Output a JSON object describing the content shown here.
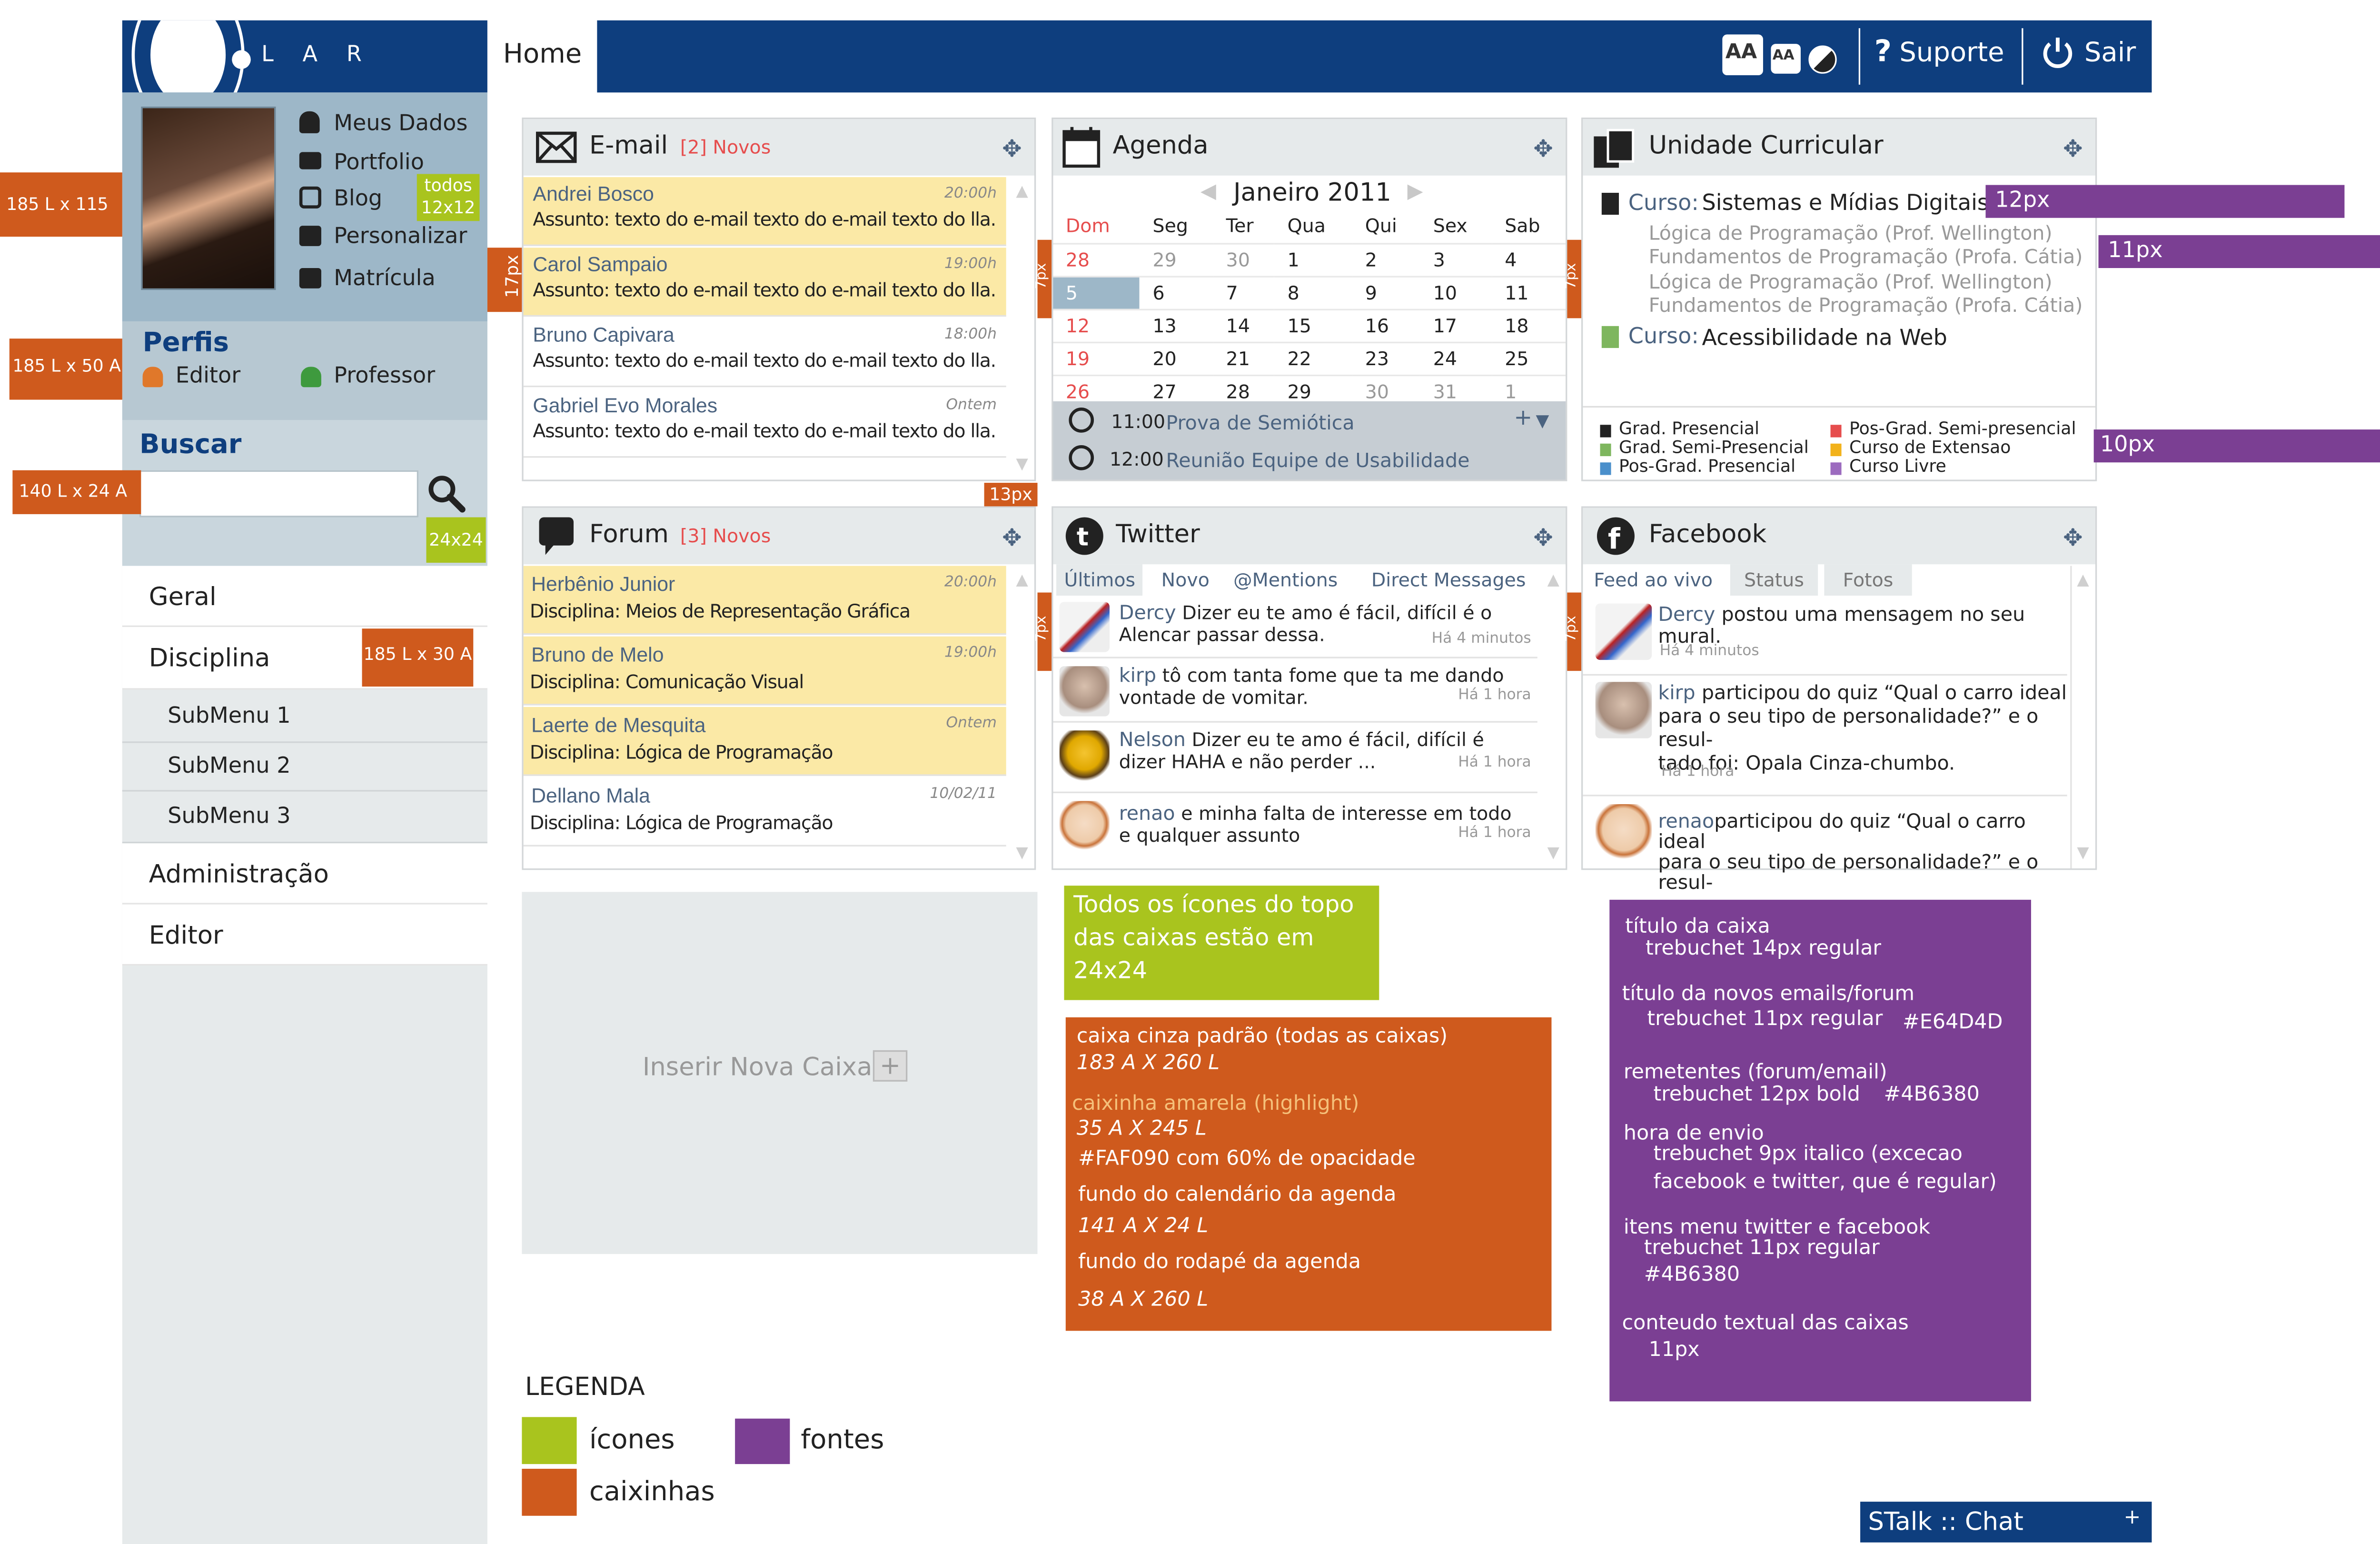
{
  "logo": {
    "text": "S  L A R"
  },
  "header": {
    "home": "Home",
    "font_increase": "AA",
    "font_decrease": "AA",
    "support": "Suporte",
    "logout": "Sair"
  },
  "user_menu": [
    "Meus Dados",
    "Portfolio",
    "Blog",
    "Personalizar",
    "Matrícula"
  ],
  "perfis": {
    "title": "Perfis",
    "editor": "Editor",
    "professor": "Professor"
  },
  "search": {
    "title": "Buscar",
    "placeholder": ""
  },
  "nav": {
    "geral": "Geral",
    "disciplina": "Disciplina",
    "submenus": [
      "SubMenu 1",
      "SubMenu 2",
      "SubMenu 3"
    ],
    "administracao": "Administração",
    "editor": "Editor"
  },
  "annotations": {
    "photo_size": "185 L x 115 A",
    "icons_12": "todos 12x12",
    "perfis_size": "185 L x 50 A",
    "search_size": "140 L x 24 A",
    "icon_24": "24x24",
    "menu_size": "185 L x 30 A",
    "px17": "17px",
    "px13": "13px",
    "px7a": "7px",
    "px7b": "7px",
    "px7c": "7px",
    "px7d": "7px",
    "px12": "12px",
    "px11": "11px",
    "px10": "10px"
  },
  "email": {
    "title": "E-mail",
    "new": "[2] Novos",
    "items": [
      {
        "sender": "Andrei Bosco",
        "time": "20:00h",
        "subject": "Assunto: texto do e-mail texto do e-mail texto do lla."
      },
      {
        "sender": "Carol Sampaio",
        "time": "19:00h",
        "subject": "Assunto: texto do e-mail texto do e-mail texto do lla."
      },
      {
        "sender": "Bruno Capivara",
        "time": "18:00h",
        "subject": "Assunto: texto do e-mail texto do e-mail texto do lla."
      },
      {
        "sender": "Gabriel Evo Morales",
        "time": "Ontem",
        "subject": "Assunto: texto do e-mail texto do e-mail texto do lla."
      }
    ]
  },
  "agenda": {
    "title": "Agenda",
    "month": "Janeiro 2011",
    "days": [
      "Dom",
      "Seg",
      "Ter",
      "Qua",
      "Qui",
      "Sex",
      "Sab"
    ],
    "weeks": [
      [
        "28",
        "29",
        "30",
        "1",
        "2",
        "3",
        "4"
      ],
      [
        "5",
        "6",
        "7",
        "8",
        "9",
        "10",
        "11"
      ],
      [
        "12",
        "13",
        "14",
        "15",
        "16",
        "17",
        "18"
      ],
      [
        "19",
        "20",
        "21",
        "22",
        "23",
        "24",
        "25"
      ],
      [
        "26",
        "27",
        "28",
        "29",
        "30",
        "31",
        "1"
      ]
    ],
    "events": [
      {
        "time": "11:00",
        "label": "Prova de Semiótica"
      },
      {
        "time": "12:00",
        "label": "Reunião Equipe de Usabilidade"
      }
    ],
    "add": "+"
  },
  "uc": {
    "title": "Unidade Curricular",
    "curso_label": "Curso:",
    "curso1": "Sistemas e Mídias Digitais",
    "disciplinas": [
      "Lógica de Programação (Prof. Wellington)",
      "Fundamentos de Programação (Profa. Cátia)",
      "Lógica de Programação (Prof. Wellington)",
      "Fundamentos de Programação (Profa. Cátia)"
    ],
    "curso2": "Acessibilidade na Web",
    "legend": [
      "Grad. Presencial",
      "Grad. Semi-Presencial",
      "Pos-Grad. Presencial",
      "Pos-Grad. Semi-presencial",
      "Curso de Extensao",
      "Curso Livre"
    ]
  },
  "forum": {
    "title": "Forum",
    "new": "[3] Novos",
    "items": [
      {
        "sender": "Herbênio Junior",
        "time": "20:00h",
        "subject": "Disciplina: Meios de Representação Gráfica"
      },
      {
        "sender": "Bruno de Melo",
        "time": "19:00h",
        "subject": "Disciplina: Comunicação Visual"
      },
      {
        "sender": "Laerte de Mesquita",
        "time": "Ontem",
        "subject": "Disciplina: Lógica de Programação"
      },
      {
        "sender": "Dellano Mala",
        "time": "10/02/11",
        "subject": "Disciplina: Lógica de Programação"
      }
    ]
  },
  "twitter": {
    "title": "Twitter",
    "tabs": [
      "Últimos",
      "Novo",
      "@Mentions",
      "Direct Messages"
    ],
    "items": [
      {
        "name": "Dercy",
        "text": "Dizer eu te amo é fácil, difícil é o",
        "text2": "Alencar passar dessa.",
        "time": "Há 4 minutos"
      },
      {
        "name": "kirp",
        "text": "tô com tanta fome que ta me dando",
        "text2": "vontade de vomitar.",
        "time": "Há 1 hora"
      },
      {
        "name": "Nelson",
        "text": "Dizer eu te amo é fácil, difícil é",
        "text2": "dizer HAHA e não perder ...",
        "time": "Há 1 hora"
      },
      {
        "name": "renao",
        "text": "e minha falta de interesse em todo",
        "text2": "e qualquer assunto",
        "time": "Há 1 hora"
      }
    ]
  },
  "facebook": {
    "title": "Facebook",
    "tabs": [
      "Feed ao vivo",
      "Status",
      "Fotos"
    ],
    "items": [
      {
        "name": "Dercy",
        "text": "postou uma mensagem no seu mural.",
        "time": "Há 4 minutos"
      },
      {
        "name": "kirp",
        "text": "participou do quiz “Qual o carro ideal",
        "text2": "para o seu tipo de personalidade?” e o resul-",
        "text3": "tado foi: Opala Cinza-chumbo.",
        "time": "Há 1 hora"
      },
      {
        "name": "renao",
        "text": "participou do quiz “Qual o carro ideal",
        "text2": "para o seu tipo de personalidade?” e o resul-"
      }
    ]
  },
  "insert_box": {
    "label": "Inserir Nova Caixa"
  },
  "green_note": {
    "l1": "Todos os ícones do topo",
    "l2": "das caixas estão em",
    "l3": "24x24"
  },
  "orange_note": {
    "l1": "caixa cinza padrão (todas as caixas)",
    "l2": "183 A X 260 L",
    "l3": "caixinha amarela (highlight)",
    "l4": "35 A X 245 L",
    "l5": "#FAF090 com 60% de opacidade",
    "l6": "fundo do calendário da agenda",
    "l7": "141 A X 24 L",
    "l8": "fundo do rodapé da agenda",
    "l9": "38 A X 260 L"
  },
  "purple_note": {
    "l1": "título da caixa",
    "l2": "trebuchet 14px regular",
    "l3": "título da novos emails/forum",
    "l4": "trebuchet 11px regular",
    "l4b": "#E64D4D",
    "l5": "remetentes (forum/email)",
    "l6": "trebuchet 12px bold",
    "l6b": "#4B6380",
    "l7": "hora de envio",
    "l8": "trebuchet 9px italico (excecao",
    "l9": "facebook e twitter, que é regular)",
    "l10": "itens menu twitter e facebook",
    "l11": "trebuchet 11px regular",
    "l12": "#4B6380",
    "l13": "conteudo textual das caixas",
    "l14": "11px"
  },
  "legenda": {
    "title": "LEGENDA",
    "icones": "ícones",
    "fontes": "fontes",
    "caixinhas": "caixinhas"
  },
  "chat": {
    "label": "STalk :: Chat",
    "plus": "+"
  },
  "colors": {
    "navy": "#0E3E7E",
    "sidebar": "#9DB7C8",
    "box_bg": "#E6EAEB",
    "highlight": "#FAF090",
    "accent_red": "#E64D4D",
    "sender": "#4B6380",
    "annot_orange": "#CF5A1D",
    "annot_green": "#A9C41E",
    "annot_purple": "#7B3F93"
  }
}
